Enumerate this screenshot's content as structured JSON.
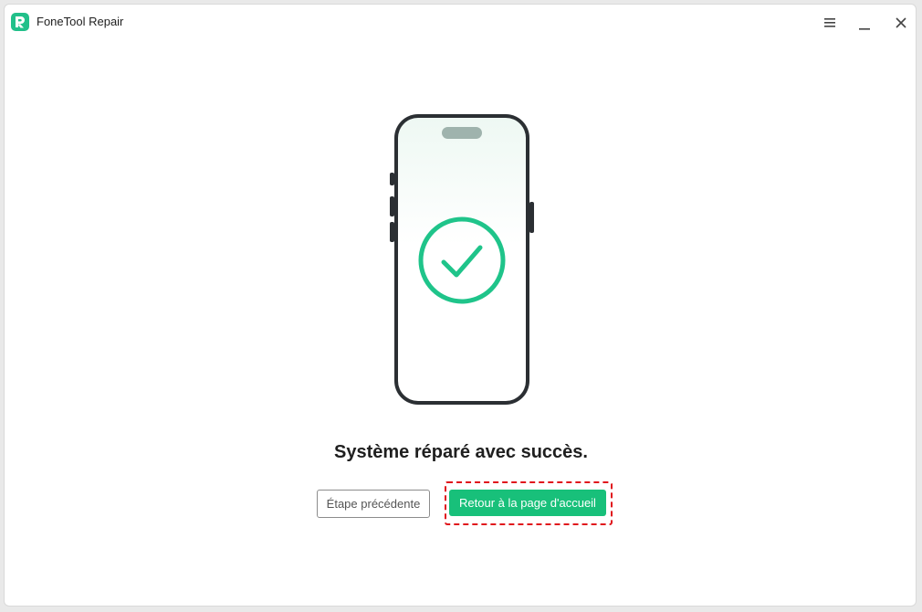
{
  "window": {
    "title": "FoneTool Repair"
  },
  "titlebar": {
    "menu_icon": "hamburger-menu-icon",
    "minimize_icon": "minimize-icon",
    "close_icon": "close-icon"
  },
  "main": {
    "illustration_icon": "phone-success-checkmark-icon",
    "status_message": "Système réparé avec succès.",
    "previous_button_label": "Étape précédente",
    "home_button_label": "Retour à la page d'accueil"
  },
  "colors": {
    "accent": "#18c07a",
    "logo": "#22c08a",
    "check": "#1fc48a",
    "highlight": "#e0161c",
    "phone_frame": "#2b2f33"
  }
}
